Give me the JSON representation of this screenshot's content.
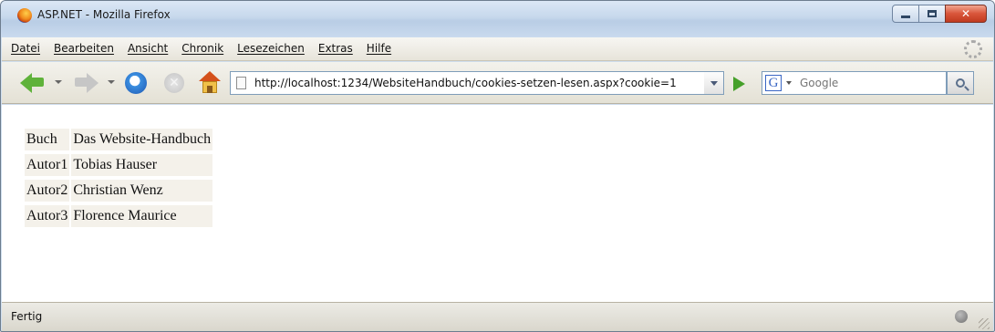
{
  "window": {
    "title": "ASP.NET - Mozilla Firefox",
    "controls": {
      "minimize": "",
      "maximize": "",
      "close": "✕"
    }
  },
  "menu": {
    "items": [
      "Datei",
      "Bearbeiten",
      "Ansicht",
      "Chronik",
      "Lesezeichen",
      "Extras",
      "Hilfe"
    ]
  },
  "toolbar": {
    "icons": [
      "back-arrow-icon",
      "forward-arrow-icon",
      "reload-icon",
      "stop-icon",
      "home-icon"
    ],
    "stop_glyph": "✕",
    "url": "http://localhost:1234/WebsiteHandbuch/cookies-setzen-lesen.aspx?cookie=1",
    "search_engine_letter": "G",
    "search_placeholder": "Google"
  },
  "content": {
    "rows": [
      {
        "key": "Buch",
        "value": "Das Website-Handbuch"
      },
      {
        "key": "Autor1",
        "value": "Tobias Hauser"
      },
      {
        "key": "Autor2",
        "value": "Christian Wenz"
      },
      {
        "key": "Autor3",
        "value": "Florence Maurice"
      }
    ]
  },
  "status": {
    "text": "Fertig"
  },
  "colors": {
    "titlebar": "#c6d8ec",
    "chrome": "#e7e4da",
    "cell_background": "#f4f1ea",
    "close_button": "#d9553a"
  }
}
